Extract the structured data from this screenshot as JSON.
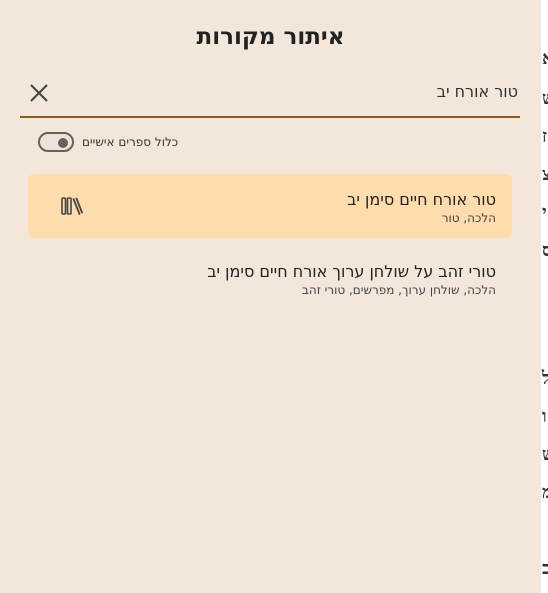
{
  "dialog": {
    "title": "איתור מקורות"
  },
  "search": {
    "value": "טור אורח יב",
    "clear_icon": "close-icon"
  },
  "toggle": {
    "label": "כלול ספרים אישיים",
    "checked": false
  },
  "results": [
    {
      "title": "טור אורח חיים סימן יב",
      "subtitle": "הלכה, טור",
      "selected": true,
      "icon": "books-icon"
    },
    {
      "title": "טורי זהב על שולחן ערוך אורח חיים סימן יב",
      "subtitle": "הלכה, שולחן ערוך, מפרשים, טורי זהב",
      "selected": false
    }
  ],
  "colors": {
    "background": "#f3e7dc",
    "selected_row": "#fedcab",
    "accent_underline": "#8a5a1e"
  }
}
